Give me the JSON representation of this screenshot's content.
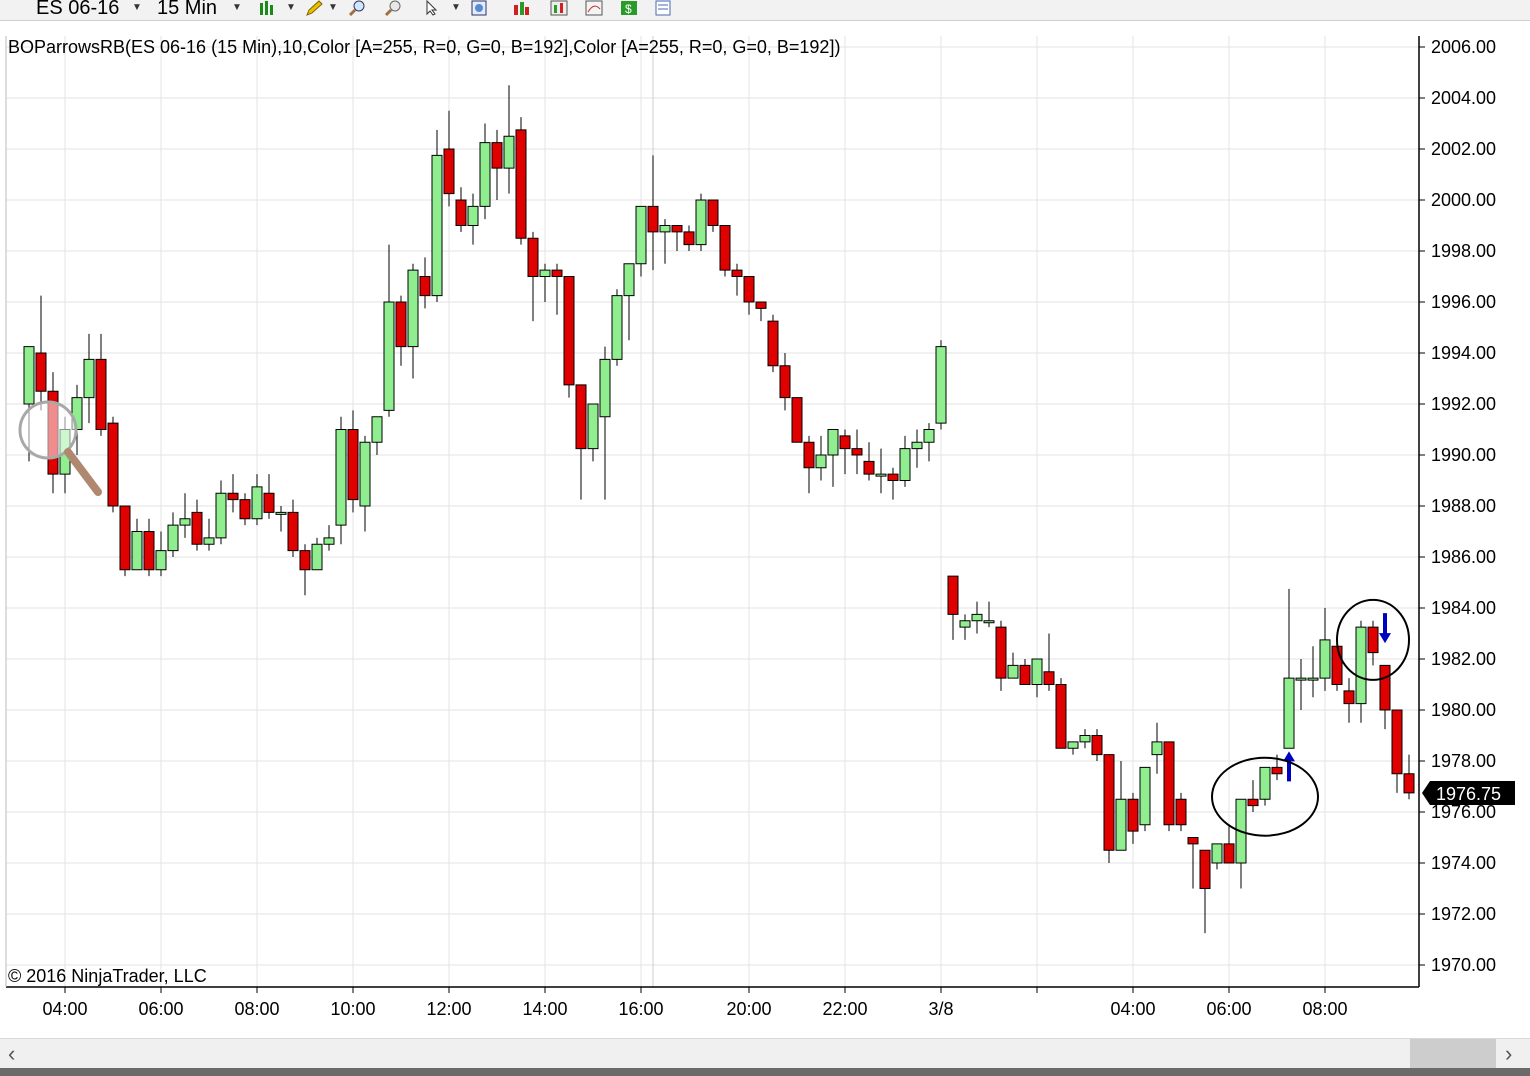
{
  "toolbar": {
    "instrument": "ES 06-16",
    "period": "15 Min",
    "icons": [
      "bar-type-icon",
      "drawing-pencil-icon",
      "zoom-in-icon",
      "zoom-out-icon",
      "cursor-icon",
      "properties-icon",
      "strategy-icon",
      "chart-style-icon",
      "template-icon",
      "money-icon",
      "data-box-icon"
    ]
  },
  "indicator_label": "BOParrowsRB(ES 06-16 (15 Min),10,Color [A=255, R=0, G=0, B=192],Color [A=255, R=0, G=0, B=192])",
  "copyright": "© 2016 NinjaTrader, LLC",
  "price_marker": "1976.75",
  "colors": {
    "up": "#90EE90",
    "down": "#E00000",
    "wick": "#000000",
    "arrow": "#0000C0",
    "grid": "#E3E3E3"
  },
  "chart_data": {
    "type": "candlestick",
    "title": "",
    "y_ticks": [
      "2006.00",
      "2004.00",
      "2002.00",
      "2000.00",
      "1998.00",
      "1996.00",
      "1994.00",
      "1992.00",
      "1990.00",
      "1988.00",
      "1986.00",
      "1984.00",
      "1982.00",
      "1980.00",
      "1978.00",
      "1976.00",
      "1974.00",
      "1972.00",
      "1970.00"
    ],
    "ylim": [
      1969.25,
      2006.25
    ],
    "x_ticks": [
      {
        "label": "04:00",
        "t": 4
      },
      {
        "label": "06:00",
        "t": 6
      },
      {
        "label": "08:00",
        "t": 8
      },
      {
        "label": "10:00",
        "t": 10
      },
      {
        "label": "12:00",
        "t": 12
      },
      {
        "label": "14:00",
        "t": 14
      },
      {
        "label": "16:00",
        "t": 16
      },
      {
        "label": "20:00",
        "t": 18.25
      },
      {
        "label": "22:00",
        "t": 20.25
      },
      {
        "label": "3/8",
        "t": 22.25
      },
      {
        "label": "04:00",
        "t": 26.25
      },
      {
        "label": "06:00",
        "t": 28.25
      },
      {
        "label": "08:00",
        "t": 30.25
      }
    ],
    "grid": true,
    "candles": [
      {
        "t": 3.25,
        "o": 1992.0,
        "h": 1993.75,
        "l": 1989.75,
        "c": 1994.25
      },
      {
        "t": 3.5,
        "o": 1994.0,
        "h": 1996.25,
        "l": 1991.75,
        "c": 1992.5
      },
      {
        "t": 3.75,
        "o": 1992.5,
        "h": 1993.25,
        "l": 1988.5,
        "c": 1989.25
      },
      {
        "t": 4.0,
        "o": 1989.25,
        "h": 1991.5,
        "l": 1988.5,
        "c": 1991.0
      },
      {
        "t": 4.25,
        "o": 1991.0,
        "h": 1992.75,
        "l": 1990.0,
        "c": 1992.25
      },
      {
        "t": 4.5,
        "o": 1992.25,
        "h": 1994.75,
        "l": 1991.25,
        "c": 1993.75
      },
      {
        "t": 4.75,
        "o": 1993.75,
        "h": 1994.75,
        "l": 1990.75,
        "c": 1991.0
      },
      {
        "t": 5.0,
        "o": 1991.25,
        "h": 1991.5,
        "l": 1987.75,
        "c": 1988.0
      },
      {
        "t": 5.25,
        "o": 1988.0,
        "h": 1988.0,
        "l": 1985.25,
        "c": 1985.5
      },
      {
        "t": 5.5,
        "o": 1985.5,
        "h": 1987.5,
        "l": 1985.5,
        "c": 1987.0
      },
      {
        "t": 5.75,
        "o": 1987.0,
        "h": 1987.5,
        "l": 1985.25,
        "c": 1985.5
      },
      {
        "t": 6.0,
        "o": 1985.5,
        "h": 1987.0,
        "l": 1985.25,
        "c": 1986.25
      },
      {
        "t": 6.25,
        "o": 1986.25,
        "h": 1987.75,
        "l": 1986.0,
        "c": 1987.25
      },
      {
        "t": 6.5,
        "o": 1987.25,
        "h": 1988.5,
        "l": 1986.75,
        "c": 1987.5
      },
      {
        "t": 6.75,
        "o": 1987.75,
        "h": 1988.25,
        "l": 1986.25,
        "c": 1986.5
      },
      {
        "t": 7.0,
        "o": 1986.5,
        "h": 1987.5,
        "l": 1986.25,
        "c": 1986.75
      },
      {
        "t": 7.25,
        "o": 1986.75,
        "h": 1989.0,
        "l": 1986.5,
        "c": 1988.5
      },
      {
        "t": 7.5,
        "o": 1988.5,
        "h": 1989.25,
        "l": 1987.75,
        "c": 1988.25
      },
      {
        "t": 7.75,
        "o": 1988.25,
        "h": 1988.5,
        "l": 1987.25,
        "c": 1987.5
      },
      {
        "t": 8.0,
        "o": 1987.5,
        "h": 1989.25,
        "l": 1987.25,
        "c": 1988.75
      },
      {
        "t": 8.25,
        "o": 1988.5,
        "h": 1989.25,
        "l": 1987.5,
        "c": 1987.75
      },
      {
        "t": 8.5,
        "o": 1987.75,
        "h": 1988.0,
        "l": 1987.0,
        "c": 1987.75
      },
      {
        "t": 8.75,
        "o": 1987.75,
        "h": 1988.25,
        "l": 1986.0,
        "c": 1986.25
      },
      {
        "t": 9.0,
        "o": 1986.25,
        "h": 1986.5,
        "l": 1984.5,
        "c": 1985.5
      },
      {
        "t": 9.25,
        "o": 1985.5,
        "h": 1986.75,
        "l": 1985.5,
        "c": 1986.5
      },
      {
        "t": 9.5,
        "o": 1986.5,
        "h": 1987.25,
        "l": 1986.25,
        "c": 1986.75
      },
      {
        "t": 9.75,
        "o": 1987.25,
        "h": 1991.5,
        "l": 1986.5,
        "c": 1991.0
      },
      {
        "t": 10.0,
        "o": 1991.0,
        "h": 1991.75,
        "l": 1987.75,
        "c": 1988.25
      },
      {
        "t": 10.25,
        "o": 1988.0,
        "h": 1990.75,
        "l": 1987.0,
        "c": 1990.5
      },
      {
        "t": 10.5,
        "o": 1990.5,
        "h": 1991.5,
        "l": 1990.0,
        "c": 1991.5
      },
      {
        "t": 10.75,
        "o": 1991.75,
        "h": 1998.25,
        "l": 1991.5,
        "c": 1996.0
      },
      {
        "t": 11.0,
        "o": 1996.0,
        "h": 1996.25,
        "l": 1993.5,
        "c": 1994.25
      },
      {
        "t": 11.25,
        "o": 1994.25,
        "h": 1997.5,
        "l": 1993.0,
        "c": 1997.25
      },
      {
        "t": 11.5,
        "o": 1997.0,
        "h": 1997.75,
        "l": 1995.75,
        "c": 1996.25
      },
      {
        "t": 11.75,
        "o": 1996.25,
        "h": 2002.75,
        "l": 1996.0,
        "c": 2001.75
      },
      {
        "t": 12.0,
        "o": 2002.0,
        "h": 2003.5,
        "l": 1999.75,
        "c": 2000.25
      },
      {
        "t": 12.25,
        "o": 2000.0,
        "h": 2000.5,
        "l": 1998.75,
        "c": 1999.0
      },
      {
        "t": 12.5,
        "o": 1999.0,
        "h": 2000.25,
        "l": 1998.25,
        "c": 1999.75
      },
      {
        "t": 12.75,
        "o": 1999.75,
        "h": 2003.0,
        "l": 1999.25,
        "c": 2002.25
      },
      {
        "t": 13.0,
        "o": 2002.25,
        "h": 2002.75,
        "l": 2000.0,
        "c": 2001.25
      },
      {
        "t": 13.25,
        "o": 2001.25,
        "h": 2004.5,
        "l": 2000.25,
        "c": 2002.5
      },
      {
        "t": 13.5,
        "o": 2002.75,
        "h": 2003.25,
        "l": 1998.25,
        "c": 1998.5
      },
      {
        "t": 13.75,
        "o": 1998.5,
        "h": 1998.75,
        "l": 1995.25,
        "c": 1997.0
      },
      {
        "t": 14.0,
        "o": 1997.0,
        "h": 1997.5,
        "l": 1996.0,
        "c": 1997.25
      },
      {
        "t": 14.25,
        "o": 1997.25,
        "h": 1997.5,
        "l": 1995.5,
        "c": 1997.0
      },
      {
        "t": 14.5,
        "o": 1997.0,
        "h": 1997.0,
        "l": 1992.25,
        "c": 1992.75
      },
      {
        "t": 14.75,
        "o": 1992.75,
        "h": 1992.75,
        "l": 1988.25,
        "c": 1990.25
      },
      {
        "t": 15.0,
        "o": 1990.25,
        "h": 1992.0,
        "l": 1989.75,
        "c": 1992.0
      },
      {
        "t": 15.25,
        "o": 1991.5,
        "h": 1994.25,
        "l": 1988.25,
        "c": 1993.75
      },
      {
        "t": 15.5,
        "o": 1993.75,
        "h": 1996.5,
        "l": 1993.5,
        "c": 1996.25
      },
      {
        "t": 15.75,
        "o": 1996.25,
        "h": 1997.5,
        "l": 1994.5,
        "c": 1997.5
      },
      {
        "t": 16.0,
        "o": 1997.5,
        "h": 1999.75,
        "l": 1997.0,
        "c": 1999.75
      },
      {
        "t": 16.25,
        "o": 1999.75,
        "h": 2001.75,
        "l": 1997.25,
        "c": 1998.75
      },
      {
        "t": 16.5,
        "o": 1998.75,
        "h": 1999.25,
        "l": 1997.5,
        "c": 1999.0
      },
      {
        "t": 16.75,
        "o": 1999.0,
        "h": 1999.0,
        "l": 1998.0,
        "c": 1998.75
      },
      {
        "t": 17.0,
        "o": 1998.75,
        "h": 1999.0,
        "l": 1998.0,
        "c": 1998.25
      },
      {
        "t": 17.25,
        "o": 1998.25,
        "h": 2000.25,
        "l": 1998.0,
        "c": 2000.0
      },
      {
        "t": 17.5,
        "o": 2000.0,
        "h": 2000.0,
        "l": 1998.75,
        "c": 1999.0
      },
      {
        "t": 17.75,
        "o": 1999.0,
        "h": 1999.0,
        "l": 1997.0,
        "c": 1997.25
      },
      {
        "t": 18.0,
        "o": 1997.25,
        "h": 1997.5,
        "l": 1996.25,
        "c": 1997.0
      },
      {
        "t": 18.25,
        "o": 1997.0,
        "h": 1997.0,
        "l": 1995.5,
        "c": 1996.0
      },
      {
        "t": 18.5,
        "o": 1996.0,
        "h": 1996.0,
        "l": 1995.25,
        "c": 1995.75
      },
      {
        "t": 18.75,
        "o": 1995.25,
        "h": 1995.5,
        "l": 1993.25,
        "c": 1993.5
      },
      {
        "t": 19.0,
        "o": 1993.5,
        "h": 1994.0,
        "l": 1991.75,
        "c": 1992.25
      },
      {
        "t": 19.25,
        "o": 1992.25,
        "h": 1992.25,
        "l": 1990.5,
        "c": 1990.5
      },
      {
        "t": 19.5,
        "o": 1990.5,
        "h": 1990.75,
        "l": 1988.5,
        "c": 1989.5
      },
      {
        "t": 19.75,
        "o": 1989.5,
        "h": 1990.75,
        "l": 1989.0,
        "c": 1990.0
      },
      {
        "t": 20.0,
        "o": 1990.0,
        "h": 1991.0,
        "l": 1988.75,
        "c": 1991.0
      },
      {
        "t": 20.25,
        "o": 1990.75,
        "h": 1991.0,
        "l": 1989.25,
        "c": 1990.25
      },
      {
        "t": 20.5,
        "o": 1990.25,
        "h": 1991.0,
        "l": 1989.25,
        "c": 1990.0
      },
      {
        "t": 20.75,
        "o": 1989.75,
        "h": 1990.5,
        "l": 1989.0,
        "c": 1989.25
      },
      {
        "t": 21.0,
        "o": 1989.25,
        "h": 1990.25,
        "l": 1988.5,
        "c": 1989.25
      },
      {
        "t": 21.25,
        "o": 1989.25,
        "h": 1989.5,
        "l": 1988.25,
        "c": 1989.0
      },
      {
        "t": 21.5,
        "o": 1989.0,
        "h": 1990.75,
        "l": 1988.75,
        "c": 1990.25
      },
      {
        "t": 21.75,
        "o": 1990.25,
        "h": 1991.0,
        "l": 1989.5,
        "c": 1990.5
      },
      {
        "t": 22.0,
        "o": 1990.5,
        "h": 1991.25,
        "l": 1989.75,
        "c": 1991.0
      },
      {
        "t": 22.25,
        "o": 1991.25,
        "h": 1994.5,
        "l": 1991.0,
        "c": 1994.25
      },
      {
        "t": 22.5,
        "o": 1985.25,
        "h": 1985.25,
        "l": 1982.75,
        "c": 1983.75
      },
      {
        "t": 22.75,
        "o": 1983.25,
        "h": 1983.75,
        "l": 1982.75,
        "c": 1983.5
      },
      {
        "t": 23.0,
        "o": 1983.5,
        "h": 1984.25,
        "l": 1983.0,
        "c": 1983.75
      },
      {
        "t": 23.25,
        "o": 1983.5,
        "h": 1984.25,
        "l": 1983.25,
        "c": 1983.5
      },
      {
        "t": 23.5,
        "o": 1983.25,
        "h": 1983.5,
        "l": 1980.75,
        "c": 1981.25
      },
      {
        "t": 23.75,
        "o": 1981.25,
        "h": 1982.25,
        "l": 1981.25,
        "c": 1981.75
      },
      {
        "t": 24.0,
        "o": 1981.75,
        "h": 1982.0,
        "l": 1981.0,
        "c": 1981.0
      },
      {
        "t": 24.25,
        "o": 1981.0,
        "h": 1982.0,
        "l": 1980.5,
        "c": 1982.0
      },
      {
        "t": 24.5,
        "o": 1981.5,
        "h": 1983.0,
        "l": 1980.75,
        "c": 1981.0
      },
      {
        "t": 24.75,
        "o": 1981.0,
        "h": 1981.25,
        "l": 1978.5,
        "c": 1978.5
      },
      {
        "t": 25.0,
        "o": 1978.5,
        "h": 1978.75,
        "l": 1978.25,
        "c": 1978.75
      },
      {
        "t": 25.25,
        "o": 1978.75,
        "h": 1979.25,
        "l": 1978.5,
        "c": 1979.0
      },
      {
        "t": 25.5,
        "o": 1979.0,
        "h": 1979.25,
        "l": 1978.0,
        "c": 1978.25
      },
      {
        "t": 25.75,
        "o": 1978.25,
        "h": 1978.25,
        "l": 1974.0,
        "c": 1974.5
      },
      {
        "t": 26.0,
        "o": 1974.5,
        "h": 1978.0,
        "l": 1974.5,
        "c": 1976.5
      },
      {
        "t": 26.25,
        "o": 1976.5,
        "h": 1976.75,
        "l": 1974.75,
        "c": 1975.25
      },
      {
        "t": 26.5,
        "o": 1975.5,
        "h": 1977.75,
        "l": 1975.25,
        "c": 1977.75
      },
      {
        "t": 26.75,
        "o": 1978.25,
        "h": 1979.5,
        "l": 1977.5,
        "c": 1978.75
      },
      {
        "t": 27.0,
        "o": 1978.75,
        "h": 1978.75,
        "l": 1975.25,
        "c": 1975.5
      },
      {
        "t": 27.25,
        "o": 1976.5,
        "h": 1976.75,
        "l": 1975.25,
        "c": 1975.5
      },
      {
        "t": 27.5,
        "o": 1975.0,
        "h": 1975.0,
        "l": 1973.0,
        "c": 1974.75
      },
      {
        "t": 27.75,
        "o": 1974.5,
        "h": 1974.5,
        "l": 1971.25,
        "c": 1973.0
      },
      {
        "t": 28.0,
        "o": 1974.0,
        "h": 1974.75,
        "l": 1973.75,
        "c": 1974.75
      },
      {
        "t": 28.25,
        "o": 1974.75,
        "h": 1975.5,
        "l": 1974.0,
        "c": 1974.0
      },
      {
        "t": 28.5,
        "o": 1974.0,
        "h": 1976.5,
        "l": 1973.0,
        "c": 1976.5
      },
      {
        "t": 28.75,
        "o": 1976.5,
        "h": 1977.25,
        "l": 1976.0,
        "c": 1976.25
      },
      {
        "t": 29.0,
        "o": 1976.5,
        "h": 1977.75,
        "l": 1976.25,
        "c": 1977.75
      },
      {
        "t": 29.25,
        "o": 1977.75,
        "h": 1978.25,
        "l": 1977.25,
        "c": 1977.5
      },
      {
        "t": 29.5,
        "o": 1978.5,
        "h": 1984.75,
        "l": 1978.5,
        "c": 1981.25
      },
      {
        "t": 29.75,
        "o": 1981.25,
        "h": 1982.0,
        "l": 1980.0,
        "c": 1981.25
      },
      {
        "t": 30.0,
        "o": 1981.25,
        "h": 1982.5,
        "l": 1980.5,
        "c": 1981.25
      },
      {
        "t": 30.25,
        "o": 1981.25,
        "h": 1984.0,
        "l": 1980.75,
        "c": 1982.75
      },
      {
        "t": 30.5,
        "o": 1982.5,
        "h": 1983.0,
        "l": 1980.75,
        "c": 1981.0
      },
      {
        "t": 30.75,
        "o": 1980.75,
        "h": 1981.25,
        "l": 1979.5,
        "c": 1980.25
      },
      {
        "t": 31.0,
        "o": 1980.25,
        "h": 1983.5,
        "l": 1979.5,
        "c": 1983.25
      },
      {
        "t": 31.25,
        "o": 1983.25,
        "h": 1983.5,
        "l": 1981.75,
        "c": 1982.25
      },
      {
        "t": 31.5,
        "o": 1981.75,
        "h": 1981.75,
        "l": 1979.25,
        "c": 1980.0
      },
      {
        "t": 31.75,
        "o": 1980.0,
        "h": 1980.0,
        "l": 1976.75,
        "c": 1977.5
      },
      {
        "t": 32.0,
        "o": 1977.5,
        "h": 1978.25,
        "l": 1976.5,
        "c": 1976.75
      }
    ],
    "signals": [
      {
        "t": 29.5,
        "price": 1977.75,
        "dir": "up"
      },
      {
        "t": 31.5,
        "price": 1983.25,
        "dir": "down"
      }
    ],
    "highlights": [
      {
        "t": 29.0,
        "price": 1976.6
      },
      {
        "t": 31.25,
        "price": 1982.75
      }
    ]
  }
}
